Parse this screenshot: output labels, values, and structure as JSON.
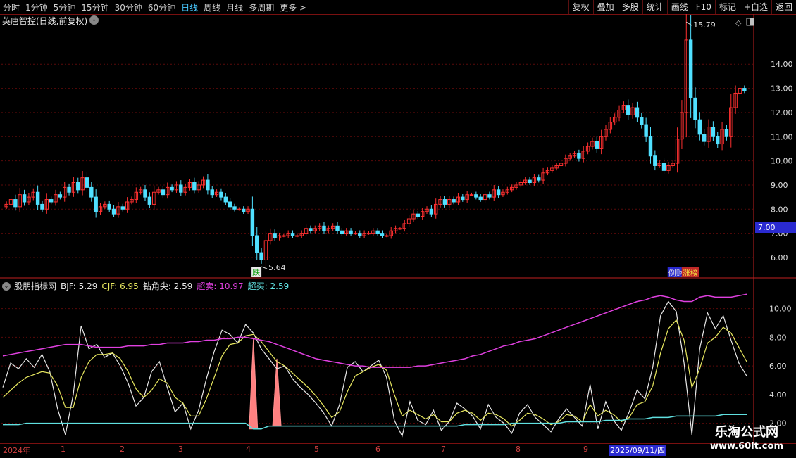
{
  "toolbar": {
    "periods": [
      "分时",
      "1分钟",
      "5分钟",
      "15分钟",
      "30分钟",
      "60分钟",
      "日线",
      "周线",
      "月线",
      "多周期",
      "更多 >"
    ],
    "active_period": "日线",
    "right_buttons": [
      "复权",
      "叠加",
      "多股",
      "统计",
      "画线",
      "F10",
      "标记",
      "+自选",
      "返回"
    ]
  },
  "stock": {
    "title": "英唐智控(日线,前复权)"
  },
  "chart_data": [
    {
      "type": "candlestick",
      "y_ticks": [
        6.0,
        7.0,
        8.0,
        9.0,
        10.0,
        11.0,
        12.0,
        13.0,
        14.0
      ],
      "ylim": [
        5.3,
        15.9
      ],
      "current_price_label": "7.00",
      "annotations": {
        "high_label": "15.79",
        "low_label": "5.64",
        "limit_down_tag": "跌",
        "limit_up_tags": [
          "例财",
          "涨榜"
        ]
      },
      "close_series": [
        8.2,
        8.4,
        8.1,
        8.6,
        8.3,
        8.5,
        8.7,
        8.2,
        8.0,
        8.4,
        8.3,
        8.6,
        8.5,
        8.9,
        8.7,
        9.1,
        8.8,
        9.3,
        8.9,
        8.5,
        7.9,
        8.1,
        8.2,
        8.0,
        7.8,
        8.1,
        8.0,
        8.3,
        8.4,
        8.7,
        8.8,
        8.5,
        8.2,
        8.7,
        8.8,
        8.6,
        8.9,
        8.8,
        9.0,
        8.7,
        8.9,
        9.1,
        8.8,
        9.0,
        9.2,
        8.8,
        8.6,
        8.7,
        8.5,
        8.3,
        8.1,
        8.0,
        8.0,
        7.9,
        8.0,
        6.9,
        6.2,
        5.9,
        6.7,
        7.0,
        6.8,
        6.9,
        6.9,
        7.0,
        6.9,
        6.9,
        7.0,
        7.2,
        7.1,
        7.2,
        7.3,
        7.1,
        7.2,
        7.3,
        7.1,
        7.0,
        7.1,
        7.0,
        7.0,
        6.9,
        7.0,
        7.0,
        7.1,
        7.0,
        6.9,
        6.9,
        7.1,
        7.2,
        7.2,
        7.4,
        7.6,
        7.8,
        7.7,
        7.9,
        8.0,
        7.8,
        8.2,
        8.4,
        8.2,
        8.4,
        8.3,
        8.5,
        8.4,
        8.6,
        8.6,
        8.5,
        8.4,
        8.6,
        8.5,
        8.8,
        8.6,
        8.7,
        8.8,
        8.9,
        9.0,
        9.1,
        9.2,
        9.1,
        9.3,
        9.2,
        9.5,
        9.6,
        9.7,
        9.8,
        9.9,
        10.1,
        10.2,
        10.3,
        10.1,
        10.4,
        10.6,
        10.8,
        10.5,
        11.0,
        11.3,
        11.6,
        11.8,
        12.1,
        12.3,
        11.9,
        12.2,
        11.8,
        11.5,
        11.0,
        10.2,
        9.8,
        9.9,
        9.6,
        9.8,
        9.9,
        10.9,
        12.0,
        15.0,
        12.6,
        11.7,
        11.1,
        10.8,
        11.4,
        11.0,
        10.7,
        11.3,
        11.0,
        12.2,
        12.8,
        13.0,
        12.9
      ]
    },
    {
      "type": "line",
      "title": "股朋指标网",
      "y_ticks": [
        2.0,
        4.0,
        6.0,
        8.0,
        10.0
      ],
      "ylim": [
        0.8,
        11.8
      ],
      "legend": [
        {
          "key": "BJF",
          "value": "5.29",
          "color": "#e8e8e8"
        },
        {
          "key": "CJF",
          "value": "6.95",
          "color": "#e8e860"
        },
        {
          "key": "钻角尖",
          "value": "2.59",
          "color": "#e8e8e8"
        },
        {
          "key": "超卖",
          "value": "10.97",
          "color": "#e040e0"
        },
        {
          "key": "超买",
          "value": "2.59",
          "color": "#60e0e0"
        }
      ],
      "series": [
        {
          "name": "BJF",
          "color": "#e8e8e8",
          "values": [
            4.5,
            6.2,
            5.8,
            6.5,
            5.9,
            6.8,
            5.6,
            3.0,
            1.2,
            4.0,
            8.8,
            7.2,
            7.5,
            6.6,
            6.9,
            6.0,
            4.8,
            3.2,
            3.8,
            5.6,
            6.3,
            4.5,
            2.8,
            3.4,
            1.6,
            2.9,
            5.1,
            7.0,
            8.5,
            8.2,
            7.6,
            8.9,
            8.3,
            7.2,
            6.5,
            5.8,
            6.0,
            5.1,
            4.5,
            4.0,
            3.4,
            2.7,
            1.8,
            3.3,
            5.9,
            6.3,
            5.6,
            6.0,
            6.4,
            5.2,
            2.2,
            1.1,
            3.5,
            2.2,
            1.9,
            2.9,
            1.5,
            2.1,
            3.4,
            3.0,
            2.5,
            1.6,
            3.3,
            2.4,
            2.0,
            1.3,
            2.7,
            3.3,
            2.4,
            1.9,
            1.4,
            2.3,
            3.0,
            2.4,
            1.8,
            4.7,
            1.6,
            3.5,
            2.2,
            1.5,
            2.8,
            4.3,
            3.7,
            5.9,
            9.5,
            10.5,
            9.8,
            6.2,
            1.2,
            7.2,
            9.7,
            8.6,
            9.5,
            7.8,
            6.2,
            5.3
          ]
        },
        {
          "name": "CJF",
          "color": "#e8e860",
          "values": [
            3.8,
            4.3,
            4.8,
            5.2,
            5.4,
            5.6,
            5.5,
            4.6,
            3.1,
            3.1,
            5.2,
            6.3,
            6.8,
            6.8,
            6.9,
            6.5,
            5.6,
            4.4,
            3.8,
            4.3,
            5.1,
            4.8,
            3.8,
            3.4,
            2.5,
            2.5,
            3.7,
            5.2,
            6.7,
            7.5,
            7.6,
            8.1,
            8.2,
            7.7,
            7.0,
            6.3,
            6.0,
            5.5,
            5.0,
            4.5,
            3.9,
            3.2,
            2.4,
            2.8,
            4.2,
            5.3,
            5.6,
            5.9,
            6.1,
            5.7,
            4.0,
            2.5,
            2.9,
            2.6,
            2.3,
            2.6,
            2.1,
            2.1,
            2.7,
            2.9,
            2.7,
            2.2,
            2.7,
            2.6,
            2.3,
            1.8,
            2.2,
            2.7,
            2.6,
            2.3,
            1.9,
            2.1,
            2.6,
            2.5,
            2.1,
            3.3,
            2.5,
            2.9,
            2.6,
            2.1,
            2.4,
            3.3,
            3.5,
            4.6,
            6.9,
            8.6,
            9.2,
            7.8,
            4.5,
            5.8,
            7.6,
            8.0,
            8.7,
            8.3,
            7.3,
            6.3
          ]
        },
        {
          "name": "超卖",
          "color": "#e040e0",
          "values": [
            6.7,
            6.8,
            6.9,
            7.0,
            7.1,
            7.2,
            7.3,
            7.4,
            7.5,
            7.5,
            7.5,
            7.4,
            7.3,
            7.3,
            7.3,
            7.3,
            7.4,
            7.4,
            7.4,
            7.5,
            7.5,
            7.6,
            7.6,
            7.6,
            7.7,
            7.7,
            7.8,
            7.8,
            7.9,
            7.9,
            8.0,
            8.0,
            7.9,
            7.8,
            7.7,
            7.5,
            7.3,
            7.1,
            6.9,
            6.7,
            6.5,
            6.4,
            6.3,
            6.2,
            6.1,
            6.0,
            6.0,
            5.9,
            5.9,
            5.9,
            5.9,
            5.9,
            5.9,
            6.0,
            6.0,
            6.1,
            6.2,
            6.3,
            6.4,
            6.5,
            6.7,
            6.8,
            7.0,
            7.2,
            7.4,
            7.5,
            7.7,
            7.8,
            7.9,
            8.1,
            8.3,
            8.5,
            8.7,
            8.9,
            9.1,
            9.3,
            9.5,
            9.7,
            9.9,
            10.1,
            10.3,
            10.5,
            10.6,
            10.8,
            10.9,
            10.8,
            10.6,
            10.5,
            10.5,
            10.8,
            10.9,
            10.8,
            10.8,
            10.8,
            10.9,
            11.0
          ]
        },
        {
          "name": "超买",
          "color": "#60e0e0",
          "values": [
            1.9,
            1.9,
            1.9,
            2.0,
            2.0,
            2.0,
            2.0,
            2.0,
            2.0,
            2.0,
            2.0,
            2.0,
            2.0,
            2.0,
            2.0,
            2.0,
            2.0,
            2.0,
            2.0,
            2.0,
            2.0,
            2.0,
            2.0,
            2.0,
            2.0,
            2.0,
            2.0,
            2.0,
            2.0,
            2.0,
            2.0,
            2.0,
            1.6,
            1.6,
            1.8,
            1.8,
            1.8,
            1.8,
            1.8,
            1.8,
            1.8,
            1.8,
            1.8,
            1.8,
            1.8,
            1.8,
            1.8,
            1.8,
            1.8,
            1.8,
            1.8,
            1.8,
            1.8,
            1.8,
            1.8,
            1.8,
            1.8,
            1.8,
            1.8,
            1.9,
            1.9,
            1.9,
            1.9,
            1.9,
            1.9,
            2.0,
            2.0,
            2.0,
            2.0,
            2.0,
            2.0,
            2.0,
            2.1,
            2.1,
            2.1,
            2.1,
            2.1,
            2.2,
            2.2,
            2.2,
            2.3,
            2.3,
            2.3,
            2.4,
            2.4,
            2.4,
            2.5,
            2.5,
            2.5,
            2.5,
            2.5,
            2.5,
            2.6,
            2.6,
            2.6,
            2.6
          ]
        }
      ],
      "spikes": [
        [
          32,
          7.9
        ],
        [
          35,
          6.5
        ]
      ]
    }
  ],
  "date_axis": {
    "labels": [
      "2024年",
      "1",
      "2",
      "3",
      "4",
      "5",
      "6",
      "7",
      "8",
      "9"
    ],
    "highlight": "2025/09/11/四"
  },
  "watermark": {
    "line1": "乐淘公式网",
    "line2": "www.60lt.com"
  },
  "colors": {
    "up": "#ff3030",
    "down": "#50e0ff",
    "grid": "#5a0a0a",
    "axis": "#c02020"
  }
}
